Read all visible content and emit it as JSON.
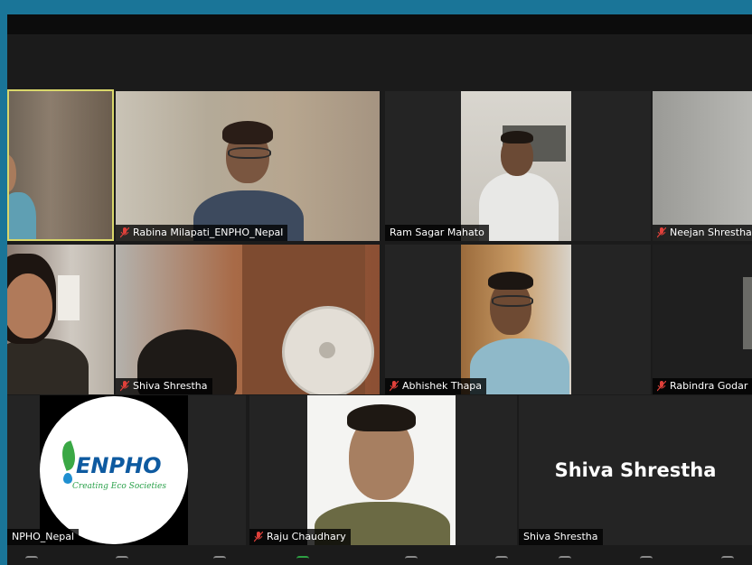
{
  "participants": {
    "p1": {
      "name": "",
      "muted": false,
      "active_speaker": true
    },
    "p2": {
      "name": "Rabina Milapati_ENPHO_Nepal",
      "muted": true
    },
    "p3": {
      "name": "Ram Sagar Mahato",
      "muted": false
    },
    "p4": {
      "name": "Neejan Shrestha",
      "muted": true
    },
    "p5": {
      "name": "",
      "muted": false
    },
    "p6": {
      "name": "Shiva Shrestha",
      "muted": true
    },
    "p7": {
      "name": "Abhishek Thapa",
      "muted": true
    },
    "p8": {
      "name": "Rabindra Godar",
      "muted": true
    },
    "p9": {
      "name": "NPHO_Nepal",
      "muted": false,
      "logo_text": "ENPHO",
      "logo_tagline": "Creating Eco Societies"
    },
    "p10": {
      "name": "Raju Chaudhary",
      "muted": true
    },
    "p11": {
      "name": "Shiva Shrestha",
      "muted": false,
      "display_name": "Shiva Shrestha"
    }
  },
  "colors": {
    "outer_background": "#1a7598",
    "meeting_background": "#1b1b1b",
    "active_speaker_border": "#d9d76a",
    "muted_icon": "#e0403a",
    "enpho_blue": "#0e5aa0",
    "enpho_green": "#2aa14a"
  }
}
